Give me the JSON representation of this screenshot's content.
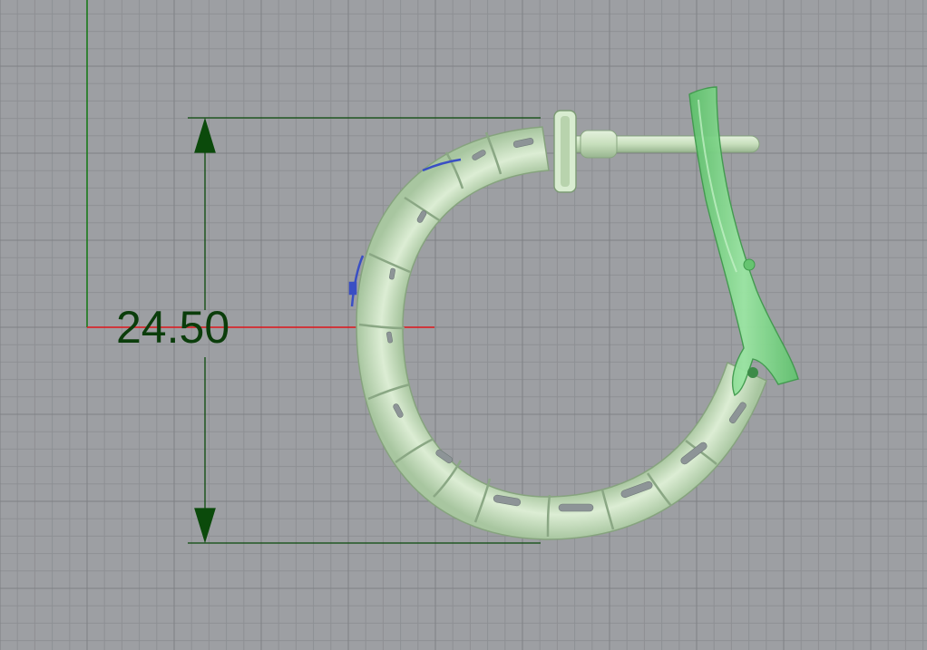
{
  "viewport": {
    "background_color": "#9d9fa3",
    "grid_color": "#8e9094",
    "grid_major_color": "#7f8185",
    "x_axis_color": "#e0151b",
    "y_axis_color": "#1a7a1a"
  },
  "dimension": {
    "value": "24.50",
    "line_color": "#0b4a0b",
    "text_color": "#0b3d0b"
  },
  "model": {
    "body_color": "#c9e3bf",
    "shade_color": "#9fbf96",
    "highlight_color": "#e6f3df",
    "slot_color": "#8d9497",
    "clasp_color": "#7fd88a",
    "clasp_edge_color": "#4fae5c",
    "stone_color": "#3a4fc4",
    "pin_color": "#c6dfbb"
  }
}
